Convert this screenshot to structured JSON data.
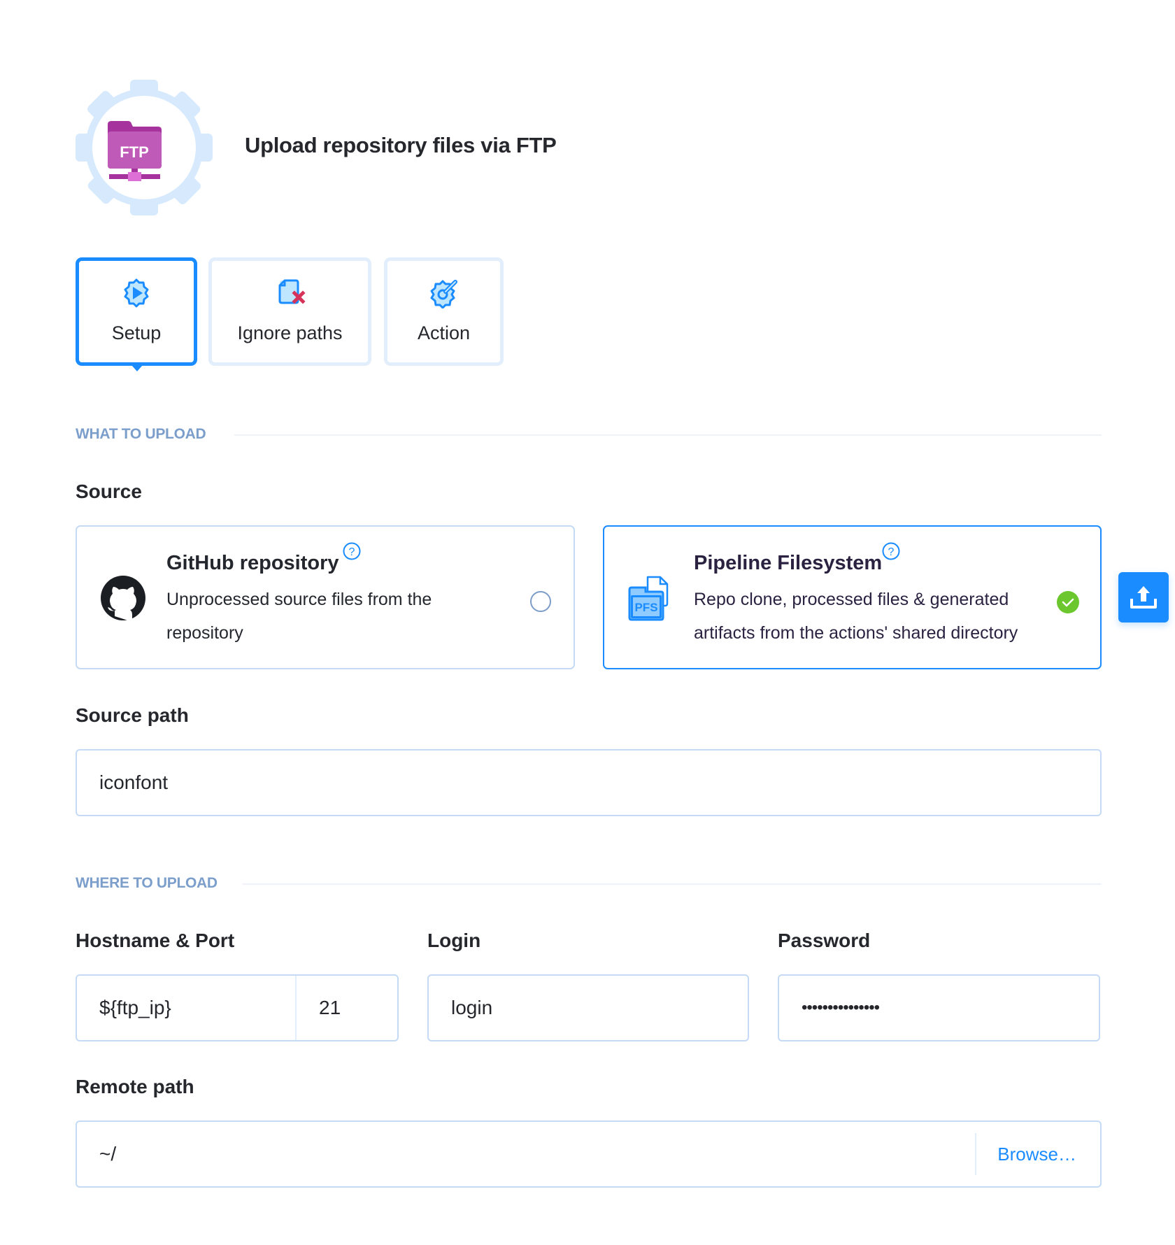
{
  "header": {
    "title": "Upload repository files via FTP",
    "logo_icon": "ftp-folder-gear-icon",
    "logo_text": "FTP"
  },
  "tabs": [
    {
      "label": "Setup",
      "icon": "gear-play-icon",
      "active": true
    },
    {
      "label": "Ignore paths",
      "icon": "file-cross-icon",
      "active": false
    },
    {
      "label": "Action",
      "icon": "gear-wrench-icon",
      "active": false
    }
  ],
  "what_to_upload": {
    "section_title": "WHAT TO UPLOAD",
    "source_label": "Source",
    "sources": [
      {
        "title": "GitHub repository",
        "description": "Unprocessed source files from the repository",
        "icon": "github-icon",
        "selected": false
      },
      {
        "title": "Pipeline Filesystem",
        "description": "Repo clone, processed files & generated artifacts from the actions' shared directory",
        "icon": "pfs-icon",
        "icon_text": "PFS",
        "selected": true
      }
    ],
    "source_path_label": "Source path",
    "source_path_value": "iconfont"
  },
  "where_to_upload": {
    "section_title": "WHERE TO UPLOAD",
    "hostname_label": "Hostname & Port",
    "hostname_value": "${ftp_ip}",
    "port_value": "21",
    "login_label": "Login",
    "login_value": "login",
    "password_label": "Password",
    "password_value": "•••••••••••••••",
    "remote_path_label": "Remote path",
    "remote_path_value": "~/",
    "browse_label": "Browse…"
  },
  "colors": {
    "accent": "#1a8cff",
    "section_title": "#7b9ecb",
    "border": "#c5daf4",
    "success": "#6cc72e",
    "ftp_purple": "#a6329e"
  }
}
